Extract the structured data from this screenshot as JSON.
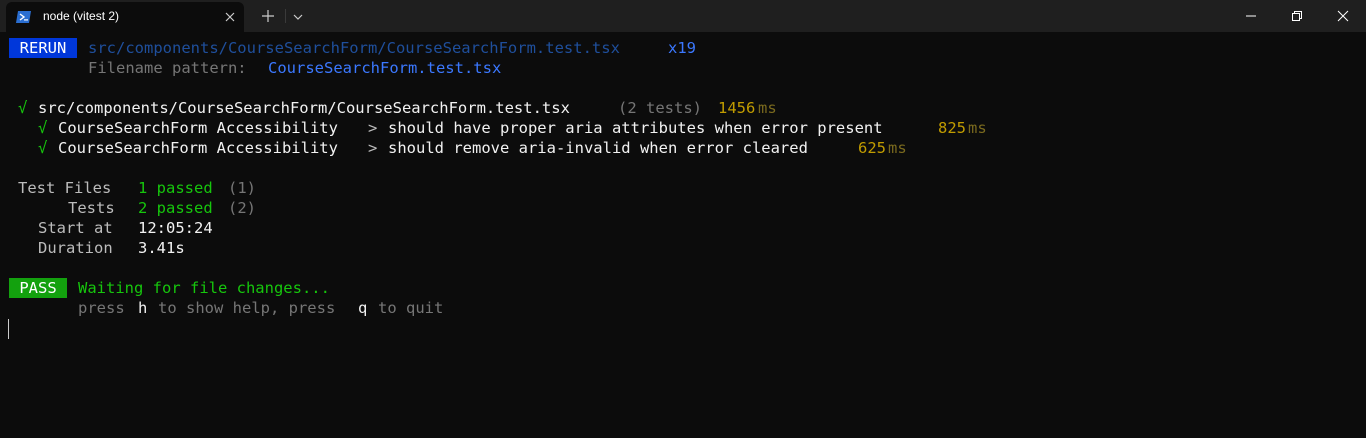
{
  "tab": {
    "title": "node (vitest 2)",
    "icon": "powershell-icon"
  },
  "terminal": {
    "rerun": {
      "badge": "RERUN",
      "path": "src/components/CourseSearchForm/CourseSearchForm.test.tsx",
      "count": "x19",
      "pattern_label": "Filename pattern:",
      "pattern_value": "CourseSearchForm.test.tsx"
    },
    "suite": {
      "check": "√",
      "path": "src/components/CourseSearchForm/CourseSearchForm.test.tsx",
      "tests_count": "(2 tests)",
      "duration_value": "1456",
      "duration_unit": "ms"
    },
    "tests": [
      {
        "check": "√",
        "suite": "CourseSearchForm Accessibility",
        "separator": ">",
        "name": "should have proper aria attributes when error present",
        "duration_value": "825",
        "duration_unit": "ms"
      },
      {
        "check": "√",
        "suite": "CourseSearchForm Accessibility",
        "separator": ">",
        "name": "should remove aria-invalid when error cleared",
        "duration_value": "625",
        "duration_unit": "ms"
      }
    ],
    "summary": {
      "test_files_label": "Test Files",
      "test_files_value": "1 passed",
      "test_files_total": "(1)",
      "tests_label": "Tests",
      "tests_value": "2 passed",
      "tests_total": "(2)",
      "start_label": "Start at",
      "start_value": "12:05:24",
      "duration_label": "Duration",
      "duration_value": "3.41s"
    },
    "watch": {
      "badge": "PASS",
      "message": "Waiting for file changes...",
      "help_press1": "press",
      "help_key1": "h",
      "help_mid": "to show help, press",
      "help_key2": "q",
      "help_end": "to quit"
    }
  },
  "colors": {
    "background": "#0c0c0c",
    "rerun_badge": "#0037da",
    "pass_badge": "#13a10e",
    "green": "#16c60c",
    "yellow": "#c19c00",
    "blue": "#3b78ff"
  }
}
